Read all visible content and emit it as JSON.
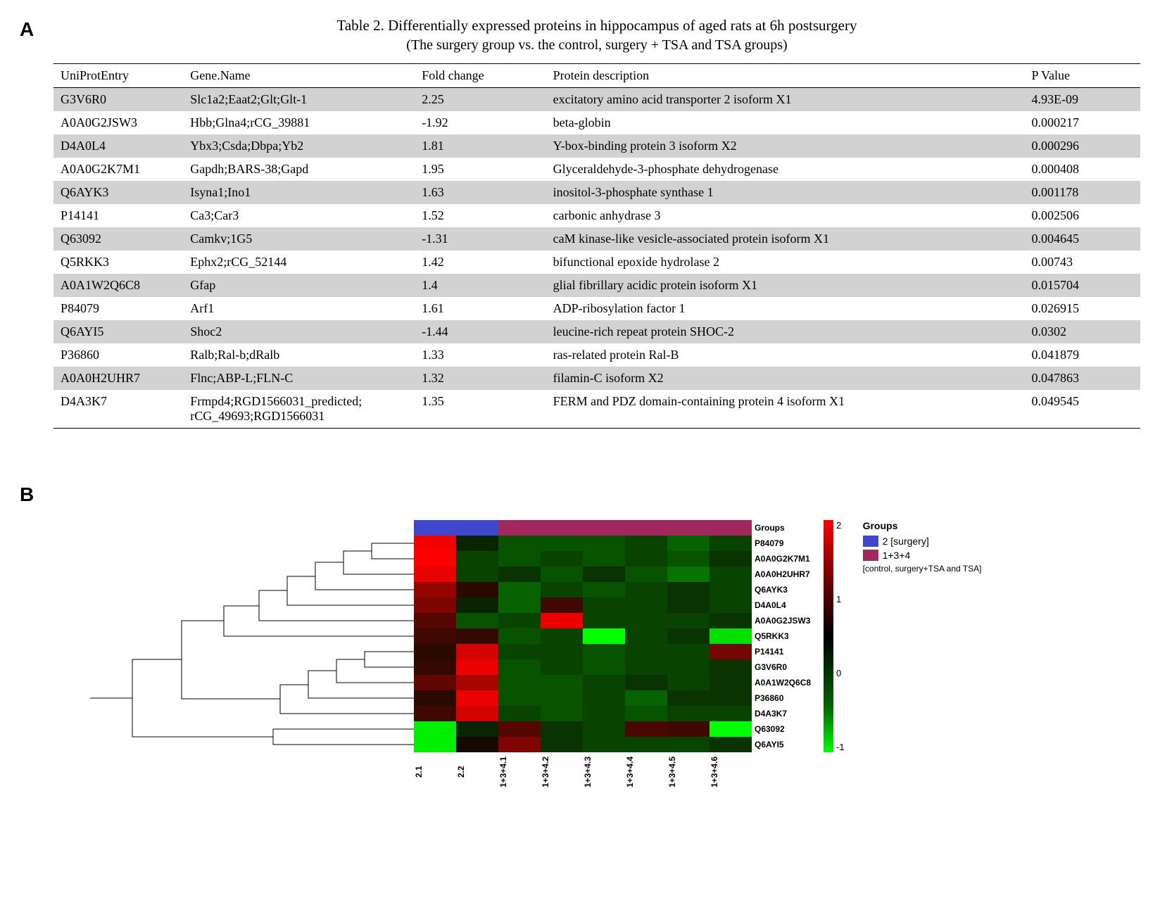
{
  "panelA": {
    "label": "A"
  },
  "panelB": {
    "label": "B"
  },
  "table": {
    "title": "Table 2. Differentially expressed proteins in hippocampus of aged rats at 6h postsurgery",
    "subtitle": "(The surgery group vs. the control, surgery + TSA and TSA groups)",
    "headers": [
      "UniProtEntry",
      "Gene.Name",
      "Fold change",
      "Protein description",
      "P Value"
    ],
    "rows": [
      [
        "G3V6R0",
        "Slc1a2;Eaat2;Glt;Glt-1",
        "2.25",
        "excitatory amino acid transporter 2 isoform X1",
        "4.93E-09"
      ],
      [
        "A0A0G2JSW3",
        "Hbb;Glna4;rCG_39881",
        "-1.92",
        "beta-globin",
        "0.000217"
      ],
      [
        "D4A0L4",
        "Ybx3;Csda;Dbpa;Yb2",
        "1.81",
        "Y-box-binding protein 3 isoform X2",
        "0.000296"
      ],
      [
        "A0A0G2K7M1",
        "Gapdh;BARS-38;Gapd",
        "1.95",
        "Glyceraldehyde-3-phosphate dehydrogenase",
        "0.000408"
      ],
      [
        "Q6AYK3",
        "Isyna1;Ino1",
        "1.63",
        "inositol-3-phosphate synthase 1",
        "0.001178"
      ],
      [
        "P14141",
        "Ca3;Car3",
        "1.52",
        "carbonic anhydrase 3",
        "0.002506"
      ],
      [
        "Q63092",
        "Camkv;1G5",
        "-1.31",
        "caM kinase-like vesicle-associated protein isoform X1",
        "0.004645"
      ],
      [
        "Q5RKK3",
        "Ephx2;rCG_52144",
        "1.42",
        "bifunctional epoxide hydrolase 2",
        "0.00743"
      ],
      [
        "A0A1W2Q6C8",
        "Gfap",
        "1.4",
        "glial fibrillary acidic protein isoform X1",
        "0.015704"
      ],
      [
        "P84079",
        "Arf1",
        "1.61",
        "ADP-ribosylation factor 1",
        "0.026915"
      ],
      [
        "Q6AYI5",
        "Shoc2",
        "-1.44",
        "leucine-rich repeat protein SHOC-2",
        "0.0302"
      ],
      [
        "P36860",
        "Ralb;Ral-b;dRalb",
        "1.33",
        "ras-related protein Ral-B",
        "0.041879"
      ],
      [
        "A0A0H2UHR7",
        "Flnc;ABP-L;FLN-C",
        "1.32",
        "filamin-C isoform X2",
        "0.047863"
      ],
      [
        "D4A3K7",
        "Frmpd4;RGD1566031_predicted;\nrCG_49693;RGD1566031",
        "1.35",
        "FERM and PDZ domain-containing protein 4 isoform X1",
        "0.049545"
      ]
    ]
  },
  "heatmap": {
    "group_header_label": "Groups",
    "sample_groups": [
      "2",
      "2",
      "1+3+4",
      "1+3+4",
      "1+3+4",
      "1+3+4",
      "1+3+4",
      "1+3+4"
    ],
    "row_labels": [
      "P84079",
      "A0A0G2K7M1",
      "A0A0H2UHR7",
      "Q6AYK3",
      "D4A0L4",
      "A0A0G2JSW3",
      "Q5RKK3",
      "P14141",
      "G3V6R0",
      "A0A1W2Q6C8",
      "P36860",
      "D4A3K7",
      "Q63092",
      "Q6AYI5"
    ],
    "col_labels": [
      "2.1",
      "2.2",
      "1+3+4.1",
      "1+3+4.2",
      "1+3+4.3",
      "1+3+4.4",
      "1+3+4.5",
      "1+3+4.6"
    ],
    "colorbar_ticks": [
      "2",
      "1",
      "0",
      "-1"
    ],
    "chart_data": {
      "type": "heatmap",
      "rows": [
        "P84079",
        "A0A0G2K7M1",
        "A0A0H2UHR7",
        "Q6AYK3",
        "D4A0L4",
        "A0A0G2JSW3",
        "Q5RKK3",
        "P14141",
        "G3V6R0",
        "A0A1W2Q6C8",
        "P36860",
        "D4A3K7",
        "Q63092",
        "Q6AYI5"
      ],
      "cols": [
        "2.1",
        "2.2",
        "1+3+4.1",
        "1+3+4.2",
        "1+3+4.3",
        "1+3+4.4",
        "1+3+4.5",
        "1+3+4.6"
      ],
      "z": [
        [
          2.1,
          -0.1,
          -0.4,
          -0.4,
          -0.4,
          -0.3,
          -0.5,
          -0.3
        ],
        [
          2.2,
          -0.3,
          -0.4,
          -0.3,
          -0.4,
          -0.3,
          -0.4,
          -0.2
        ],
        [
          2.0,
          -0.3,
          -0.2,
          -0.4,
          -0.2,
          -0.4,
          -0.6,
          -0.3
        ],
        [
          1.2,
          0.2,
          -0.5,
          -0.3,
          -0.4,
          -0.3,
          -0.2,
          -0.3
        ],
        [
          1.0,
          -0.1,
          -0.5,
          0.4,
          -0.3,
          -0.3,
          -0.2,
          -0.3
        ],
        [
          0.6,
          -0.4,
          -0.3,
          2.0,
          -0.3,
          -0.3,
          -0.3,
          -0.2
        ],
        [
          0.4,
          0.3,
          -0.4,
          -0.3,
          -1.5,
          -0.3,
          -0.2,
          -1.3
        ],
        [
          0.2,
          1.8,
          -0.3,
          -0.3,
          -0.4,
          -0.3,
          -0.3,
          0.9
        ],
        [
          0.3,
          2.0,
          -0.4,
          -0.3,
          -0.4,
          -0.3,
          -0.3,
          -0.2
        ],
        [
          0.7,
          1.4,
          -0.4,
          -0.4,
          -0.3,
          -0.2,
          -0.3,
          -0.2
        ],
        [
          0.2,
          2.0,
          -0.4,
          -0.4,
          -0.3,
          -0.5,
          -0.2,
          -0.2
        ],
        [
          0.4,
          1.8,
          -0.3,
          -0.4,
          -0.3,
          -0.4,
          -0.3,
          -0.3
        ],
        [
          -1.4,
          -0.1,
          0.6,
          -0.2,
          -0.3,
          0.5,
          0.4,
          -1.5
        ],
        [
          -1.4,
          0.0,
          1.0,
          -0.2,
          -0.3,
          -0.3,
          -0.3,
          -0.2
        ]
      ],
      "zlim": [
        -1.5,
        2.2
      ],
      "dendrogram_row": true,
      "group_bar": {
        "2.1": "2",
        "2.2": "2",
        "1+3+4.1": "1+3+4",
        "1+3+4.2": "1+3+4",
        "1+3+4.3": "1+3+4",
        "1+3+4.4": "1+3+4",
        "1+3+4.5": "1+3+4",
        "1+3+4.6": "1+3+4"
      }
    }
  },
  "legend": {
    "title": "Groups",
    "items": [
      {
        "color": "#3f48cc",
        "label": "2 [surgery]"
      },
      {
        "color": "#a0285c",
        "label": "1+3+4"
      }
    ],
    "subnote": "[control, surgery+TSA and TSA]"
  }
}
